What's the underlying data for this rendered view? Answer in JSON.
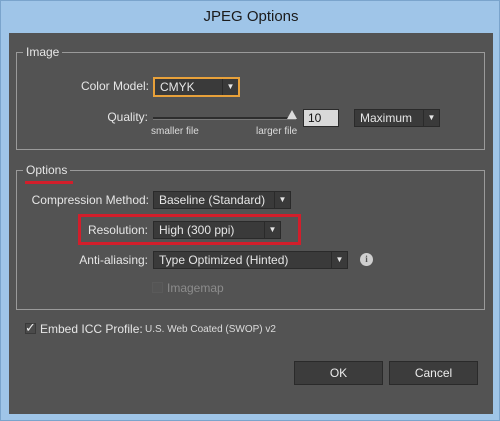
{
  "window": {
    "title": "JPEG Options"
  },
  "image_group": {
    "legend": "Image",
    "color_model_label": "Color Model:",
    "color_model_value": "CMYK",
    "quality_label": "Quality:",
    "quality_value": "10",
    "quality_preset": "Maximum",
    "smaller_file": "smaller file",
    "larger_file": "larger file"
  },
  "options_group": {
    "legend": "Options",
    "compression_label": "Compression Method:",
    "compression_value": "Baseline (Standard)",
    "resolution_label": "Resolution:",
    "resolution_value": "High (300 ppi)",
    "antialiasing_label": "Anti-aliasing:",
    "antialiasing_value": "Type Optimized (Hinted)",
    "imagemap_label": "Imagemap",
    "imagemap_checked": false
  },
  "embed_icc": {
    "label": "Embed ICC Profile:",
    "profile": "U.S. Web Coated (SWOP) v2",
    "checked": true
  },
  "buttons": {
    "ok": "OK",
    "cancel": "Cancel"
  },
  "annotation_color": "#d21e2b",
  "icons": {
    "dropdown": "chevron-down-icon",
    "info": "info-icon",
    "check": "checkmark-icon"
  }
}
